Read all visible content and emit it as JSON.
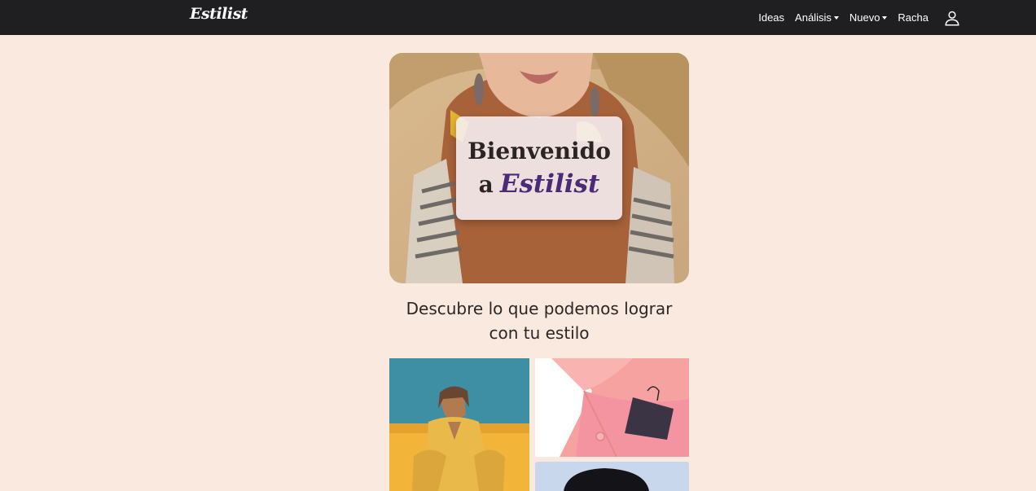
{
  "navbar": {
    "brand": "Estilist",
    "items": [
      {
        "label": "Ideas",
        "dropdown": false
      },
      {
        "label": "Análisis",
        "dropdown": true
      },
      {
        "label": "Nuevo",
        "dropdown": true
      },
      {
        "label": "Racha",
        "dropdown": false
      }
    ],
    "user_icon": "user-icon"
  },
  "hero": {
    "image": "woman-straw-hat-photo",
    "welcome_line1": "Bienvenido",
    "welcome_prefix": "a",
    "welcome_brand": "Estilist"
  },
  "tagline": "Descubre lo que podemos lograr con tu estilo",
  "gallery": [
    {
      "image": "man-yellow-outfit-photo"
    },
    {
      "image": "pink-shirt-tag-photo"
    },
    {
      "image": "person-portrait-photo"
    }
  ],
  "colors": {
    "navbar_bg": "#1f1e21",
    "page_bg": "#fae9de",
    "brand_accent": "#4b2a78"
  }
}
